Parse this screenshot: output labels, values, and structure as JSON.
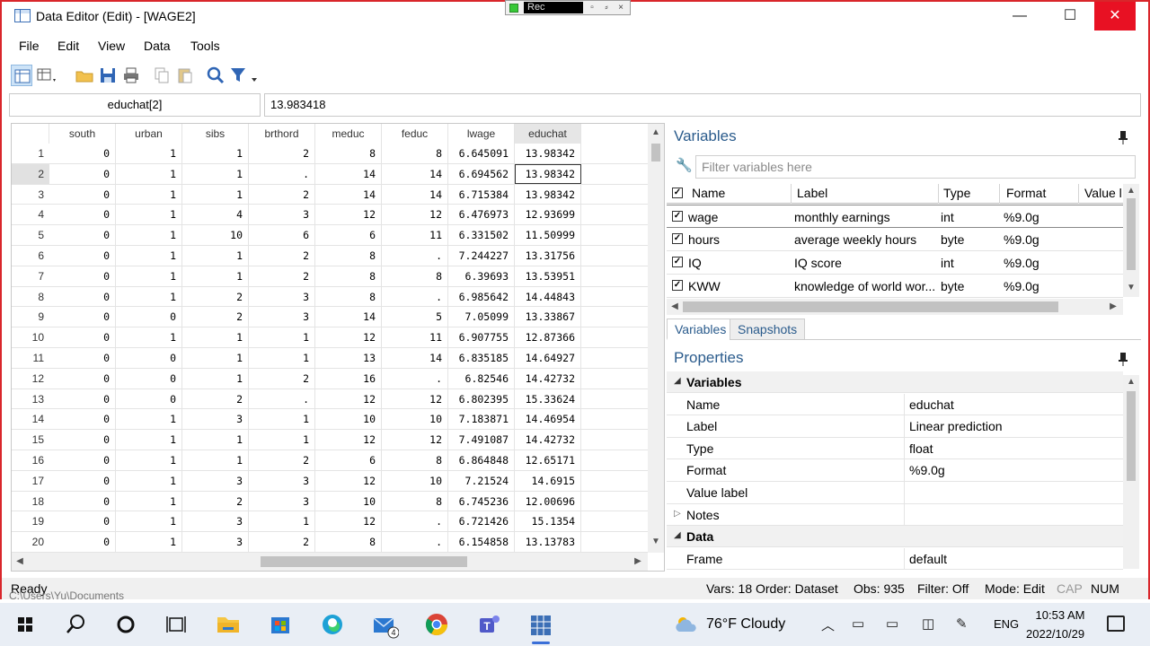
{
  "window": {
    "title": "Data Editor (Edit) - [WAGE2]",
    "rec_label": "Rec",
    "minimize": "—",
    "maximize": "☐",
    "close": "✕"
  },
  "menu": [
    "File",
    "Edit",
    "View",
    "Data",
    "Tools"
  ],
  "cellbar": {
    "name": "educhat[2]",
    "value": "13.983418"
  },
  "grid": {
    "columns": [
      "south",
      "urban",
      "sibs",
      "brthord",
      "meduc",
      "feduc",
      "lwage",
      "educhat"
    ],
    "selected_column": "educhat",
    "selected_row": 2,
    "rows": [
      [
        "1",
        "0",
        "1",
        "1",
        "2",
        "8",
        "8",
        "6.645091",
        "13.98342"
      ],
      [
        "2",
        "0",
        "1",
        "1",
        ".",
        "14",
        "14",
        "6.694562",
        "13.98342"
      ],
      [
        "3",
        "0",
        "1",
        "1",
        "2",
        "14",
        "14",
        "6.715384",
        "13.98342"
      ],
      [
        "4",
        "0",
        "1",
        "4",
        "3",
        "12",
        "12",
        "6.476973",
        "12.93699"
      ],
      [
        "5",
        "0",
        "1",
        "10",
        "6",
        "6",
        "11",
        "6.331502",
        "11.50999"
      ],
      [
        "6",
        "0",
        "1",
        "1",
        "2",
        "8",
        ".",
        "7.244227",
        "13.31756"
      ],
      [
        "7",
        "0",
        "1",
        "1",
        "2",
        "8",
        "8",
        "6.39693",
        "13.53951"
      ],
      [
        "8",
        "0",
        "1",
        "2",
        "3",
        "8",
        ".",
        "6.985642",
        "14.44843"
      ],
      [
        "9",
        "0",
        "0",
        "2",
        "3",
        "14",
        "5",
        "7.05099",
        "13.33867"
      ],
      [
        "10",
        "0",
        "1",
        "1",
        "1",
        "12",
        "11",
        "6.907755",
        "12.87366"
      ],
      [
        "11",
        "0",
        "0",
        "1",
        "1",
        "13",
        "14",
        "6.835185",
        "14.64927"
      ],
      [
        "12",
        "0",
        "0",
        "1",
        "2",
        "16",
        ".",
        "6.82546",
        "14.42732"
      ],
      [
        "13",
        "0",
        "0",
        "2",
        ".",
        "12",
        "12",
        "6.802395",
        "15.33624"
      ],
      [
        "14",
        "0",
        "1",
        "3",
        "1",
        "10",
        "10",
        "7.183871",
        "14.46954"
      ],
      [
        "15",
        "0",
        "1",
        "1",
        "1",
        "12",
        "12",
        "7.491087",
        "14.42732"
      ],
      [
        "16",
        "0",
        "1",
        "1",
        "2",
        "6",
        "8",
        "6.864848",
        "12.65171"
      ],
      [
        "17",
        "0",
        "1",
        "3",
        "3",
        "12",
        "10",
        "7.21524",
        "14.6915"
      ],
      [
        "18",
        "0",
        "1",
        "2",
        "3",
        "10",
        "8",
        "6.745236",
        "12.00696"
      ],
      [
        "19",
        "0",
        "1",
        "3",
        "1",
        "12",
        ".",
        "6.721426",
        "15.1354"
      ],
      [
        "20",
        "0",
        "1",
        "3",
        "2",
        "8",
        ".",
        "6.154858",
        "13.13783"
      ]
    ]
  },
  "variables_panel": {
    "title": "Variables",
    "filter_placeholder": "Filter variables here",
    "columns": [
      "Name",
      "Label",
      "Type",
      "Format",
      "Value l"
    ],
    "rows": [
      {
        "name": "wage",
        "label": "monthly earnings",
        "type": "int",
        "format": "%9.0g"
      },
      {
        "name": "hours",
        "label": "average weekly hours",
        "type": "byte",
        "format": "%9.0g"
      },
      {
        "name": "IQ",
        "label": "IQ score",
        "type": "int",
        "format": "%9.0g"
      },
      {
        "name": "KWW",
        "label": "knowledge of world wor...",
        "type": "byte",
        "format": "%9.0g"
      }
    ],
    "tabs": [
      "Variables",
      "Snapshots"
    ]
  },
  "properties_panel": {
    "title": "Properties",
    "sections": [
      {
        "name": "Variables",
        "rows": [
          {
            "label": "Name",
            "value": "educhat"
          },
          {
            "label": "Label",
            "value": "Linear prediction"
          },
          {
            "label": "Type",
            "value": "float"
          },
          {
            "label": "Format",
            "value": "%9.0g"
          },
          {
            "label": "Value label",
            "value": ""
          },
          {
            "label": "Notes",
            "value": ""
          }
        ]
      },
      {
        "name": "Data",
        "rows": [
          {
            "label": "Frame",
            "value": "default"
          }
        ]
      }
    ]
  },
  "status": {
    "ready": "Ready",
    "vars": "Vars: 18",
    "order": "Order: Dataset",
    "obs": "Obs: 935",
    "filter": "Filter: Off",
    "mode": "Mode: Edit",
    "cap": "CAP",
    "num": "NUM",
    "ghost_path": "C:\\Users\\Yu\\Documents"
  },
  "taskbar": {
    "weather": "76°F  Cloudy",
    "language": "ENG",
    "time": "10:53 AM",
    "date": "2022/10/29",
    "mail_badge": "4"
  },
  "colors": {
    "frame": "#d9262b",
    "accent": "#2a5b8c",
    "selected": "#e6e6e6"
  }
}
